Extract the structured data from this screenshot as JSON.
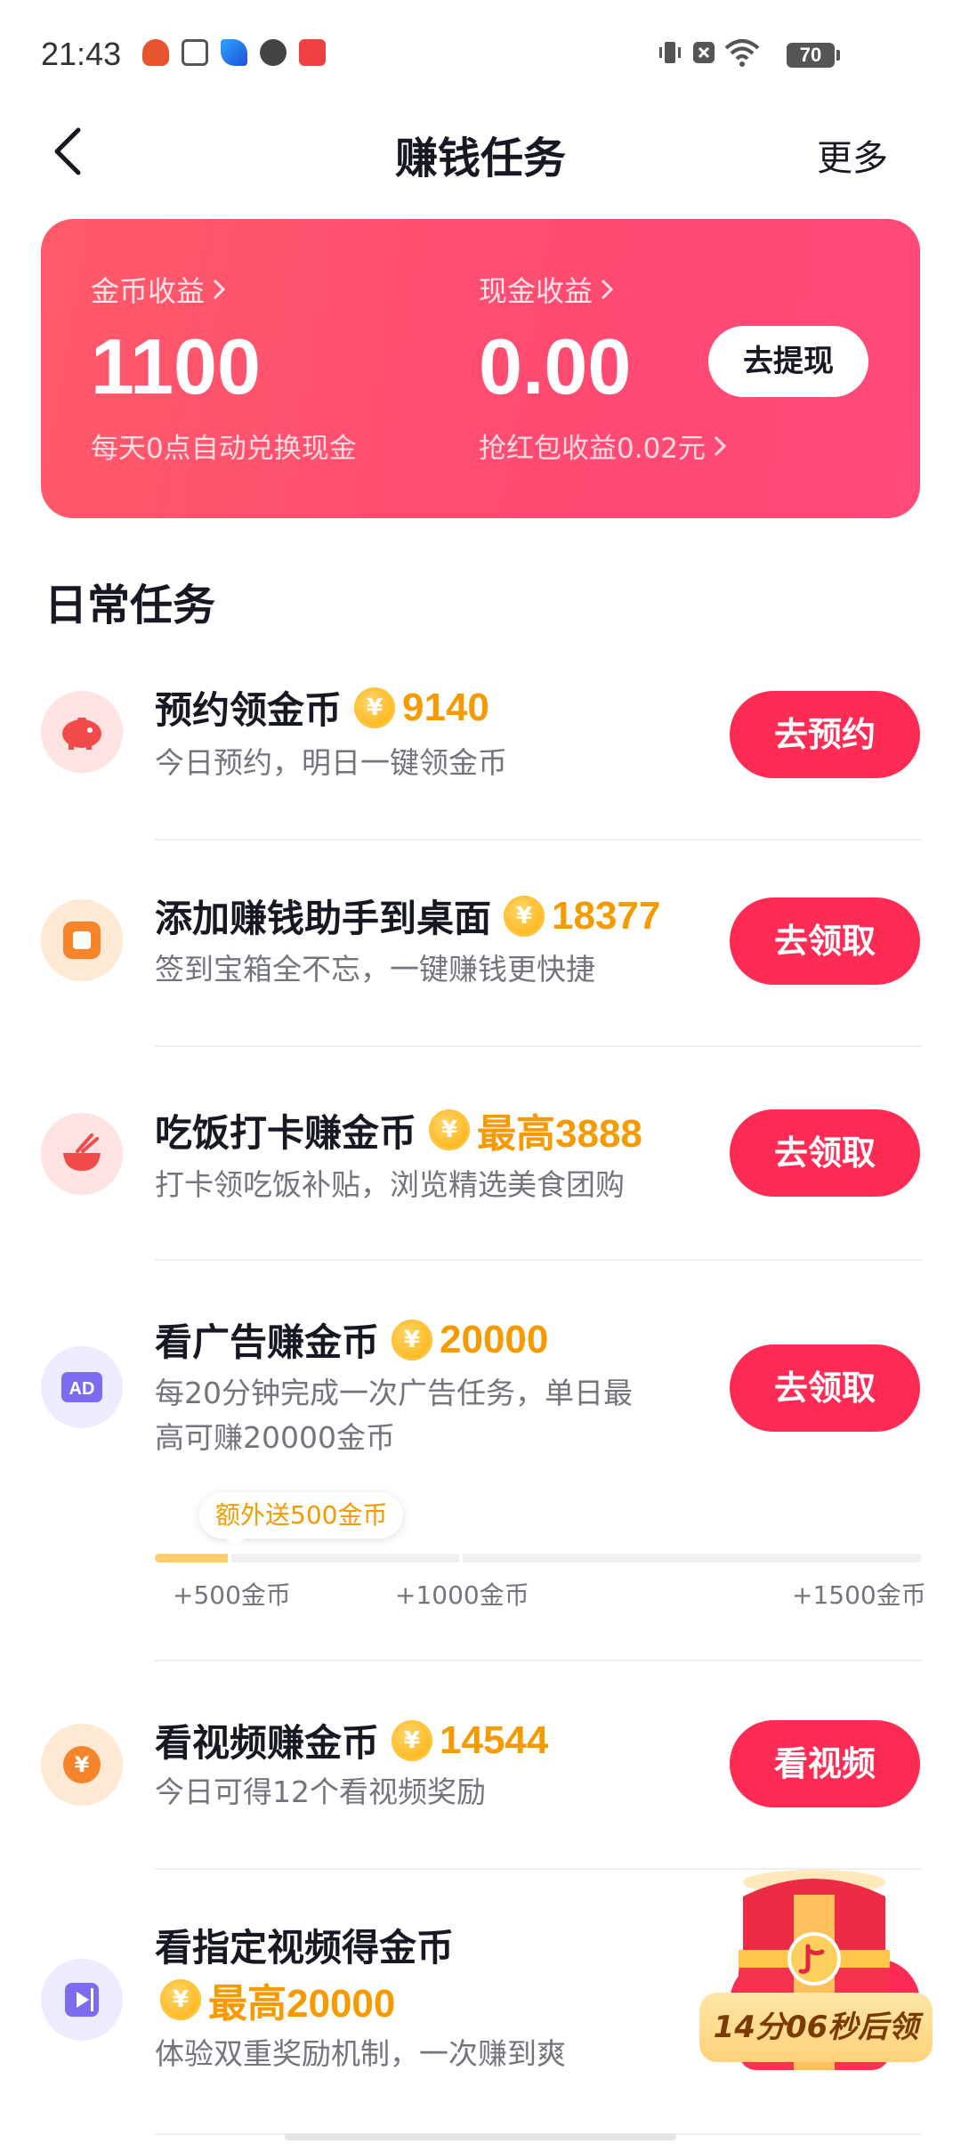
{
  "status_bar": {
    "time": "21:43",
    "battery": "70",
    "icons": [
      "app-icon-1",
      "app-icon-2",
      "app-icon-3",
      "app-icon-4",
      "toutiao-icon",
      "vibrate-icon",
      "notification-muted-icon",
      "wifi-icon",
      "battery-icon"
    ]
  },
  "header": {
    "back_icon": "chevron-left-icon",
    "title": "赚钱任务",
    "more": "更多"
  },
  "earnings": {
    "coin_label": "金币收益",
    "coin_value": "1100",
    "coin_sub": "每天0点自动兑换现金",
    "cash_label": "现金收益",
    "cash_value": "0.00",
    "cash_sub": "抢红包收益0.02元",
    "withdraw_button": "去提现",
    "colors": {
      "card_gradient_start": "#ff5a6a",
      "card_gradient_end": "#ff4a7a"
    }
  },
  "daily": {
    "section_title": "日常任务",
    "tasks": [
      {
        "title": "预约领金币",
        "reward": "9140",
        "desc": "今日预约，明日一键领金币",
        "button": "去预约",
        "icon": "piggy-bank-icon"
      },
      {
        "title": "添加赚钱助手到桌面",
        "reward": "18377",
        "desc": "签到宝箱全不忘，一键赚钱更快捷",
        "button": "去领取",
        "icon": "app-square-icon"
      },
      {
        "title": "吃饭打卡赚金币",
        "reward": "最高3888",
        "desc": "打卡领吃饭补贴，浏览精选美食团购",
        "button": "去领取",
        "icon": "rice-bowl-icon"
      },
      {
        "title": "看广告赚金币",
        "reward": "20000",
        "desc_line1": "每20分钟完成一次广告任务，单日最",
        "desc_line2": "高可赚20000金币",
        "button": "去领取",
        "icon": "ad-icon"
      },
      {
        "title": "看视频赚金币",
        "reward": "14544",
        "desc": "今日可得12个看视频奖励",
        "button": "看视频",
        "icon": "yuan-coin-icon"
      },
      {
        "title": "看指定视频得金币",
        "reward": "最高20000",
        "desc": "体验双重奖励机制，一次赚到爽",
        "icon": "video-play-icon"
      }
    ],
    "ad_progress": {
      "bonus_tip": "额外送500金币",
      "milestones": [
        "+500金币",
        "+1000金币",
        "+1500金币"
      ],
      "progress_fraction": 0.1
    }
  },
  "floating": {
    "timer_text": "14分06秒后领",
    "icon": "treasure-chest-icon"
  },
  "accent_colors": {
    "button": "#fe2c55",
    "reward": "#f59a00"
  }
}
